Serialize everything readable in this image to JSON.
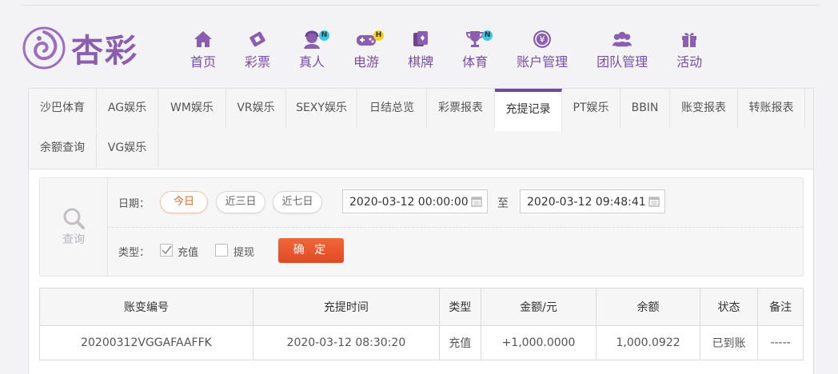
{
  "brand": {
    "name": "杏彩",
    "color": "#8b5eb0"
  },
  "nav": [
    {
      "label": "首页",
      "icon": "home-icon"
    },
    {
      "label": "彩票",
      "icon": "lottery-ticket-icon"
    },
    {
      "label": "真人",
      "icon": "live-dealer-icon",
      "badge": "N"
    },
    {
      "label": "电游",
      "icon": "gamepad-icon",
      "badge": "H"
    },
    {
      "label": "棋牌",
      "icon": "cards-icon"
    },
    {
      "label": "体育",
      "icon": "trophy-icon",
      "badge": "N"
    },
    {
      "label": "账户管理",
      "icon": "yen-icon"
    },
    {
      "label": "团队管理",
      "icon": "team-icon"
    },
    {
      "label": "活动",
      "icon": "gift-icon"
    }
  ],
  "tabs": [
    "沙巴体育",
    "AG娱乐",
    "WM娱乐",
    "VR娱乐",
    "SEXY娱乐",
    "日结总览",
    "彩票报表",
    "充提记录",
    "PT娱乐",
    "BBIN",
    "账变报表",
    "转账报表",
    "余额查询",
    "VG娱乐"
  ],
  "active_tab": "充提记录",
  "query": {
    "side_label": "查询",
    "date_label": "日期：",
    "quick_ranges": [
      "今日",
      "近三日",
      "近七日"
    ],
    "active_range": "今日",
    "start": "2020-03-12 00:00:00",
    "to_label": "至",
    "end": "2020-03-12 09:48:41",
    "type_label": "类型：",
    "types": [
      {
        "label": "充值",
        "checked": true
      },
      {
        "label": "提现",
        "checked": false
      }
    ],
    "confirm_label": "确 定"
  },
  "table": {
    "headers": [
      "账变编号",
      "充提时间",
      "类型",
      "金额/元",
      "余额",
      "状态",
      "备注"
    ],
    "rows": [
      [
        "20200312VGGAFAAFFK",
        "2020-03-12 08:30:20",
        "充值",
        "+1,000.0000",
        "1,000.0922",
        "已到账",
        "-----"
      ]
    ]
  },
  "colors": {
    "accent": "#6f4b96",
    "nav_text": "#7a4fa3",
    "confirm": "#e8522d",
    "amount": "#d42a2a",
    "status_ok": "#4caa2b"
  }
}
